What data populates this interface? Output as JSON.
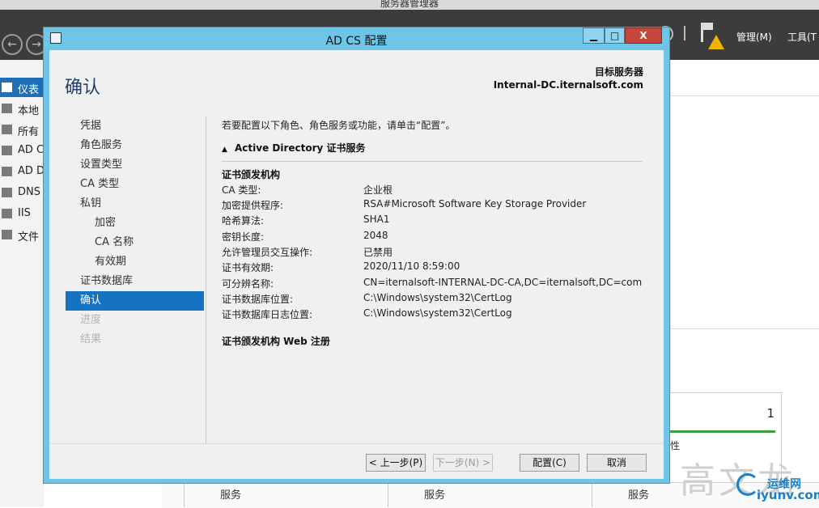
{
  "background": {
    "title": "服务器管理器",
    "toolbar": {
      "manage": "管理(M)",
      "tools": "工具(T"
    },
    "sidebar": [
      "仪表",
      "本地",
      "所有",
      "AD C",
      "AD D",
      "DNS",
      "IIS",
      "文件"
    ],
    "tile_count": "1",
    "tile_label": "性",
    "services": [
      "服务",
      "服务",
      "服务"
    ],
    "watermark": "高文龙",
    "site": "运维网",
    "site_url": "iyunv.com"
  },
  "dialog": {
    "title": "AD CS 配置",
    "page_title": "确认",
    "target_label": "目标服务器",
    "target_server": "Internal-DC.iternalsoft.com",
    "nav": [
      {
        "label": "凭据",
        "state": "normal",
        "level": 0
      },
      {
        "label": "角色服务",
        "state": "normal",
        "level": 0
      },
      {
        "label": "设置类型",
        "state": "normal",
        "level": 0
      },
      {
        "label": "CA 类型",
        "state": "normal",
        "level": 0
      },
      {
        "label": "私钥",
        "state": "normal",
        "level": 0
      },
      {
        "label": "加密",
        "state": "normal",
        "level": 1
      },
      {
        "label": "CA 名称",
        "state": "normal",
        "level": 1
      },
      {
        "label": "有效期",
        "state": "normal",
        "level": 1
      },
      {
        "label": "证书数据库",
        "state": "normal",
        "level": 0
      },
      {
        "label": "确认",
        "state": "active",
        "level": 0
      },
      {
        "label": "进度",
        "state": "disabled",
        "level": 0
      },
      {
        "label": "结果",
        "state": "disabled",
        "level": 0
      }
    ],
    "intro": "若要配置以下角色、角色服务或功能，请单击“配置”。",
    "section": "Active Directory 证书服务",
    "group1": "证书颁发机构",
    "details": [
      {
        "key": "CA 类型:",
        "value": "企业根"
      },
      {
        "key": "加密提供程序:",
        "value": "RSA#Microsoft Software Key Storage Provider"
      },
      {
        "key": "哈希算法:",
        "value": "SHA1"
      },
      {
        "key": "密钥长度:",
        "value": "2048"
      },
      {
        "key": "允许管理员交互操作:",
        "value": "已禁用"
      },
      {
        "key": "证书有效期:",
        "value": "2020/11/10 8:59:00"
      },
      {
        "key": "可分辨名称:",
        "value": "CN=iternalsoft-INTERNAL-DC-CA,DC=iternalsoft,DC=com"
      },
      {
        "key": "证书数据库位置:",
        "value": "C:\\Windows\\system32\\CertLog"
      },
      {
        "key": "证书数据库日志位置:",
        "value": "C:\\Windows\\system32\\CertLog"
      }
    ],
    "group2": "证书颁发机构 Web 注册",
    "buttons": {
      "prev": "< 上一步(P)",
      "next": "下一步(N) >",
      "configure": "配置(C)",
      "cancel": "取消"
    },
    "window_buttons": {
      "minimize": "▁",
      "maximize": "□",
      "close": "X"
    }
  },
  "colors": {
    "accent": "#1673c1",
    "dialog_frame": "#6dc5e8",
    "title_blue": "#1e3f6e"
  }
}
